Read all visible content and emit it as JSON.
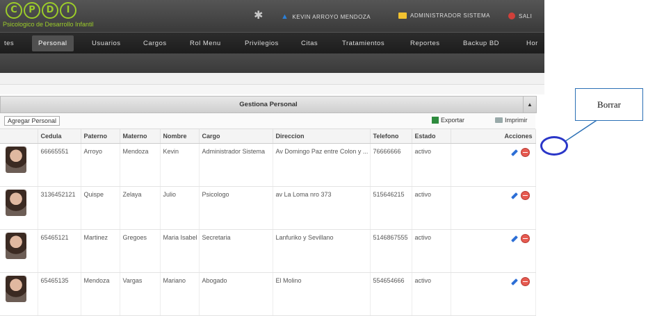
{
  "header": {
    "logo_letters": [
      "C",
      "P",
      "D",
      "I"
    ],
    "logo_subtitle": "Psicologico de Desarrollo Infantil",
    "user_name": "KEVIN ARROYO MENDOZA",
    "role": "ADMINISTRADOR SISTEMA",
    "exit_label": "SALI"
  },
  "menu": {
    "items": [
      {
        "label": "tes",
        "active": false
      },
      {
        "label": "Personal",
        "active": true
      },
      {
        "label": "Usuarios",
        "active": false
      },
      {
        "label": "Cargos",
        "active": false
      },
      {
        "label": "Rol Menu",
        "active": false
      },
      {
        "label": "Privilegios",
        "active": false
      },
      {
        "label": "Citas",
        "active": false
      },
      {
        "label": "Tratamientos",
        "active": false
      },
      {
        "label": "Reportes",
        "active": false
      },
      {
        "label": "Backup BD",
        "active": false
      },
      {
        "label": "Hor",
        "active": false
      }
    ]
  },
  "panel": {
    "title": "Gestiona Personal",
    "add_label": "Agregar Personal",
    "export_label": "Exportar",
    "print_label": "Imprimir",
    "columns": [
      "",
      "Cedula",
      "Paterno",
      "Materno",
      "Nombre",
      "Cargo",
      "Direccion",
      "Telefono",
      "Estado",
      "Acciones"
    ],
    "rows": [
      {
        "cedula": "66665551",
        "paterno": "Arroyo",
        "materno": "Mendoza",
        "nombre": "Kevin",
        "cargo": "Administrador Sistema",
        "direccion": "Av Domingo Paz entre Colon y ...",
        "telefono": "76666666",
        "estado": "activo"
      },
      {
        "cedula": "3136452121",
        "paterno": "Quispe",
        "materno": "Zelaya",
        "nombre": "Julio",
        "cargo": "Psicologo",
        "direccion": "av La Loma nro 373",
        "telefono": "515646215",
        "estado": "activo"
      },
      {
        "cedula": "65465121",
        "paterno": "Martinez",
        "materno": "Gregoes",
        "nombre": "Maria Isabel",
        "cargo": "Secretaria",
        "direccion": "Lanfuriko y Sevillano",
        "telefono": "5146867555",
        "estado": "activo"
      },
      {
        "cedula": "65465135",
        "paterno": "Mendoza",
        "materno": "Vargas",
        "nombre": "Mariano",
        "cargo": "Abogado",
        "direccion": "El Molino",
        "telefono": "554654666",
        "estado": "activo"
      }
    ]
  },
  "annotation": {
    "label": "Borrar"
  }
}
